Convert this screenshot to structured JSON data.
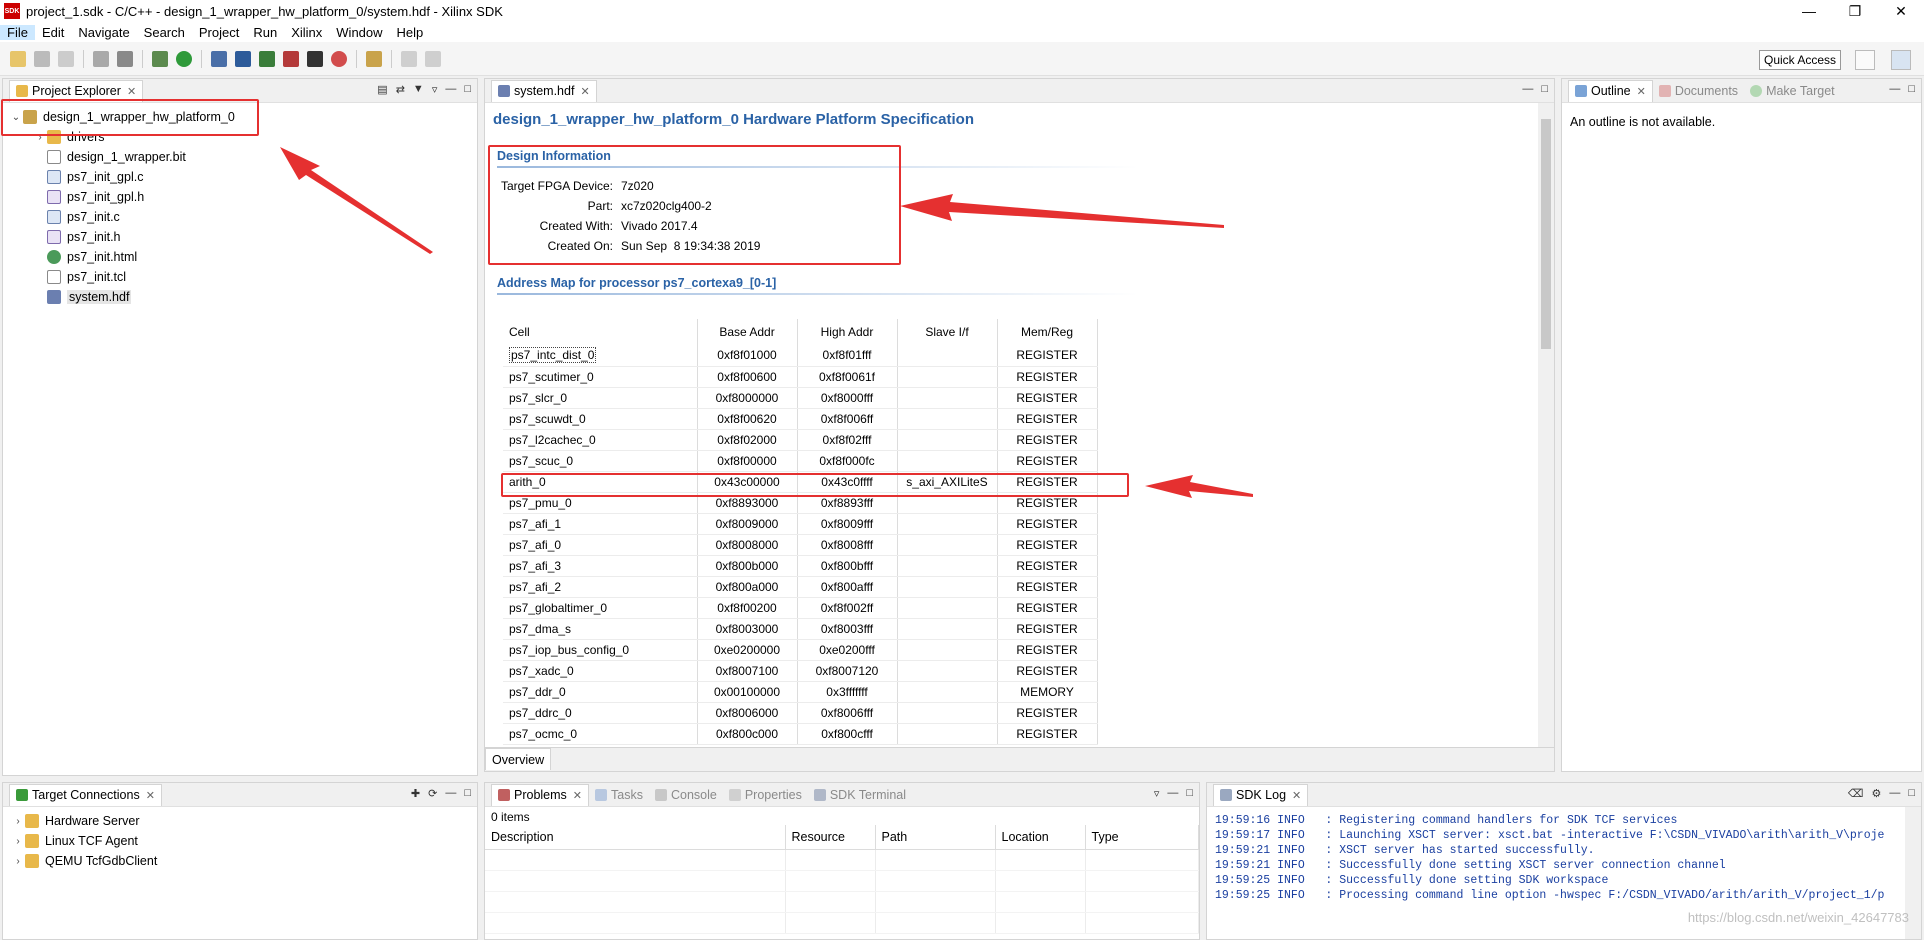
{
  "window": {
    "title": "project_1.sdk - C/C++ - design_1_wrapper_hw_platform_0/system.hdf - Xilinx SDK",
    "app_icon_label": "SDK",
    "minimize": "—",
    "restore": "❐",
    "close": "✕"
  },
  "menu": {
    "items": [
      "File",
      "Edit",
      "Navigate",
      "Search",
      "Project",
      "Run",
      "Xilinx",
      "Window",
      "Help"
    ]
  },
  "toolbar": {
    "quick_access": "Quick Access"
  },
  "project_explorer": {
    "tab": "Project Explorer",
    "root": "design_1_wrapper_hw_platform_0",
    "items": [
      {
        "label": "drivers",
        "icon": "folder-icon"
      },
      {
        "label": "design_1_wrapper.bit",
        "icon": "file-icon"
      },
      {
        "label": "ps7_init_gpl.c",
        "icon": "c-file-icon"
      },
      {
        "label": "ps7_init_gpl.h",
        "icon": "h-file-icon"
      },
      {
        "label": "ps7_init.c",
        "icon": "c-file-icon"
      },
      {
        "label": "ps7_init.h",
        "icon": "h-file-icon"
      },
      {
        "label": "ps7_init.html",
        "icon": "globe-icon"
      },
      {
        "label": "ps7_init.tcl",
        "icon": "file-icon"
      },
      {
        "label": "system.hdf",
        "icon": "hdf-file-icon"
      }
    ]
  },
  "editor": {
    "tab": "system.hdf",
    "title": "design_1_wrapper_hw_platform_0 Hardware Platform Specification",
    "design_info": {
      "heading": "Design Information",
      "rows": [
        {
          "label": "Target FPGA Device:",
          "value": "7z020"
        },
        {
          "label": "Part:",
          "value": "xc7z020clg400-2"
        },
        {
          "label": "Created With:",
          "value": "Vivado 2017.4"
        },
        {
          "label": "Created On:",
          "value": "Sun Sep  8 19:34:38 2019"
        }
      ]
    },
    "address_map": {
      "heading": "Address Map for processor ps7_cortexa9_[0-1]",
      "columns": [
        "Cell",
        "Base Addr",
        "High Addr",
        "Slave I/f",
        "Mem/Reg"
      ],
      "rows": [
        [
          "ps7_intc_dist_0",
          "0xf8f01000",
          "0xf8f01fff",
          "",
          "REGISTER"
        ],
        [
          "ps7_scutimer_0",
          "0xf8f00600",
          "0xf8f0061f",
          "",
          "REGISTER"
        ],
        [
          "ps7_slcr_0",
          "0xf8000000",
          "0xf8000fff",
          "",
          "REGISTER"
        ],
        [
          "ps7_scuwdt_0",
          "0xf8f00620",
          "0xf8f006ff",
          "",
          "REGISTER"
        ],
        [
          "ps7_l2cachec_0",
          "0xf8f02000",
          "0xf8f02fff",
          "",
          "REGISTER"
        ],
        [
          "ps7_scuc_0",
          "0xf8f00000",
          "0xf8f000fc",
          "",
          "REGISTER"
        ],
        [
          "arith_0",
          "0x43c00000",
          "0x43c0ffff",
          "s_axi_AXILiteS",
          "REGISTER"
        ],
        [
          "ps7_pmu_0",
          "0xf8893000",
          "0xf8893fff",
          "",
          "REGISTER"
        ],
        [
          "ps7_afi_1",
          "0xf8009000",
          "0xf8009fff",
          "",
          "REGISTER"
        ],
        [
          "ps7_afi_0",
          "0xf8008000",
          "0xf8008fff",
          "",
          "REGISTER"
        ],
        [
          "ps7_afi_3",
          "0xf800b000",
          "0xf800bfff",
          "",
          "REGISTER"
        ],
        [
          "ps7_afi_2",
          "0xf800a000",
          "0xf800afff",
          "",
          "REGISTER"
        ],
        [
          "ps7_globaltimer_0",
          "0xf8f00200",
          "0xf8f002ff",
          "",
          "REGISTER"
        ],
        [
          "ps7_dma_s",
          "0xf8003000",
          "0xf8003fff",
          "",
          "REGISTER"
        ],
        [
          "ps7_iop_bus_config_0",
          "0xe0200000",
          "0xe0200fff",
          "",
          "REGISTER"
        ],
        [
          "ps7_xadc_0",
          "0xf8007100",
          "0xf8007120",
          "",
          "REGISTER"
        ],
        [
          "ps7_ddr_0",
          "0x00100000",
          "0x3fffffff",
          "",
          "MEMORY"
        ],
        [
          "ps7_ddrc_0",
          "0xf8006000",
          "0xf8006fff",
          "",
          "REGISTER"
        ],
        [
          "ps7_ocmc_0",
          "0xf800c000",
          "0xf800cfff",
          "",
          "REGISTER"
        ]
      ]
    },
    "bottom_tab": "Overview"
  },
  "outline": {
    "tabs": [
      "Outline",
      "Documents",
      "Make Target"
    ],
    "message": "An outline is not available."
  },
  "target_connections": {
    "tab": "Target Connections",
    "items": [
      "Hardware Server",
      "Linux TCF Agent",
      "QEMU TcfGdbClient"
    ]
  },
  "problems": {
    "tabs": [
      "Problems",
      "Tasks",
      "Console",
      "Properties",
      "SDK Terminal"
    ],
    "count": "0 items",
    "columns": [
      "Description",
      "Resource",
      "Path",
      "Location",
      "Type"
    ]
  },
  "sdk_log": {
    "tab": "SDK Log",
    "lines": [
      "19:59:16 INFO   : Registering command handlers for SDK TCF services",
      "19:59:17 INFO   : Launching XSCT server: xsct.bat -interactive F:\\CSDN_VIVADO\\arith\\arith_V\\proje",
      "19:59:21 INFO   : XSCT server has started successfully.",
      "19:59:21 INFO   : Successfully done setting XSCT server connection channel",
      "19:59:25 INFO   : Successfully done setting SDK workspace",
      "19:59:25 INFO   : Processing command line option -hwspec F:/CSDN_VIVADO/arith/arith_V/project_1/p"
    ],
    "watermark": "https://blog.csdn.net/weixin_42647783"
  },
  "colors": {
    "accent": "#2a62a6",
    "annotation_red": "#e53030",
    "log_text": "#1a3fa0"
  }
}
